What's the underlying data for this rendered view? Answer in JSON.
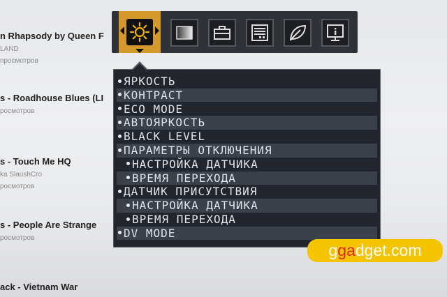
{
  "background_list": [
    {
      "title": "n Rhapsody by Queen F",
      "subs": [
        "LAND",
        "просмотров"
      ]
    },
    {
      "title": "s - Roadhouse Blues (LI",
      "subs": [
        "росмотров"
      ]
    },
    {
      "title": "s - Touch Me HQ",
      "subs": [
        "ka SlaushCro",
        "росмотров"
      ]
    },
    {
      "title": "s - People Are Strange",
      "subs": [
        "росмотров"
      ]
    },
    {
      "title": "ack - Vietnam War",
      "subs": []
    }
  ],
  "osd": {
    "tabs": [
      {
        "name": "picture-brightness-tab",
        "icon": "sun-icon",
        "active": true
      },
      {
        "name": "color-tab",
        "icon": "gradient-icon",
        "active": false
      },
      {
        "name": "toolbox-tab",
        "icon": "toolbox-icon",
        "active": false
      },
      {
        "name": "input-tab",
        "icon": "list-panel-icon",
        "active": false
      },
      {
        "name": "eco-tab",
        "icon": "leaf-icon",
        "active": false
      },
      {
        "name": "info-tab",
        "icon": "monitor-info-icon",
        "active": false
      }
    ],
    "menu_items": [
      {
        "label": "ЯРКОСТЬ",
        "sub": false
      },
      {
        "label": "КОНТРАСТ",
        "sub": false
      },
      {
        "label": "ECO MODE",
        "sub": false
      },
      {
        "label": "АВТОЯРКОСТЬ",
        "sub": false
      },
      {
        "label": "BLACK LEVEL",
        "sub": false
      },
      {
        "label": "ПАРАМЕТРЫ ОТКЛЮЧЕНИЯ",
        "sub": false
      },
      {
        "label": "НАСТРОЙКА ДАТЧИКА",
        "sub": true
      },
      {
        "label": "ВРЕМЯ ПЕРЕХОДА",
        "sub": true
      },
      {
        "label": "ДАТЧИК ПРИСУТСТВИЯ",
        "sub": false
      },
      {
        "label": "НАСТРОЙКА ДАТЧИКА",
        "sub": true
      },
      {
        "label": "ВРЕМЯ ПЕРЕХОДА",
        "sub": true
      },
      {
        "label": "DV MODE",
        "sub": false
      }
    ]
  },
  "watermark": {
    "part1": "g",
    "part2": "ga",
    "part3": "dget.com"
  },
  "colors": {
    "accent": "#d4982b",
    "menu_bg": "#22262c",
    "stripe": "#3b4148",
    "watermark_bg": "#f4c400"
  }
}
